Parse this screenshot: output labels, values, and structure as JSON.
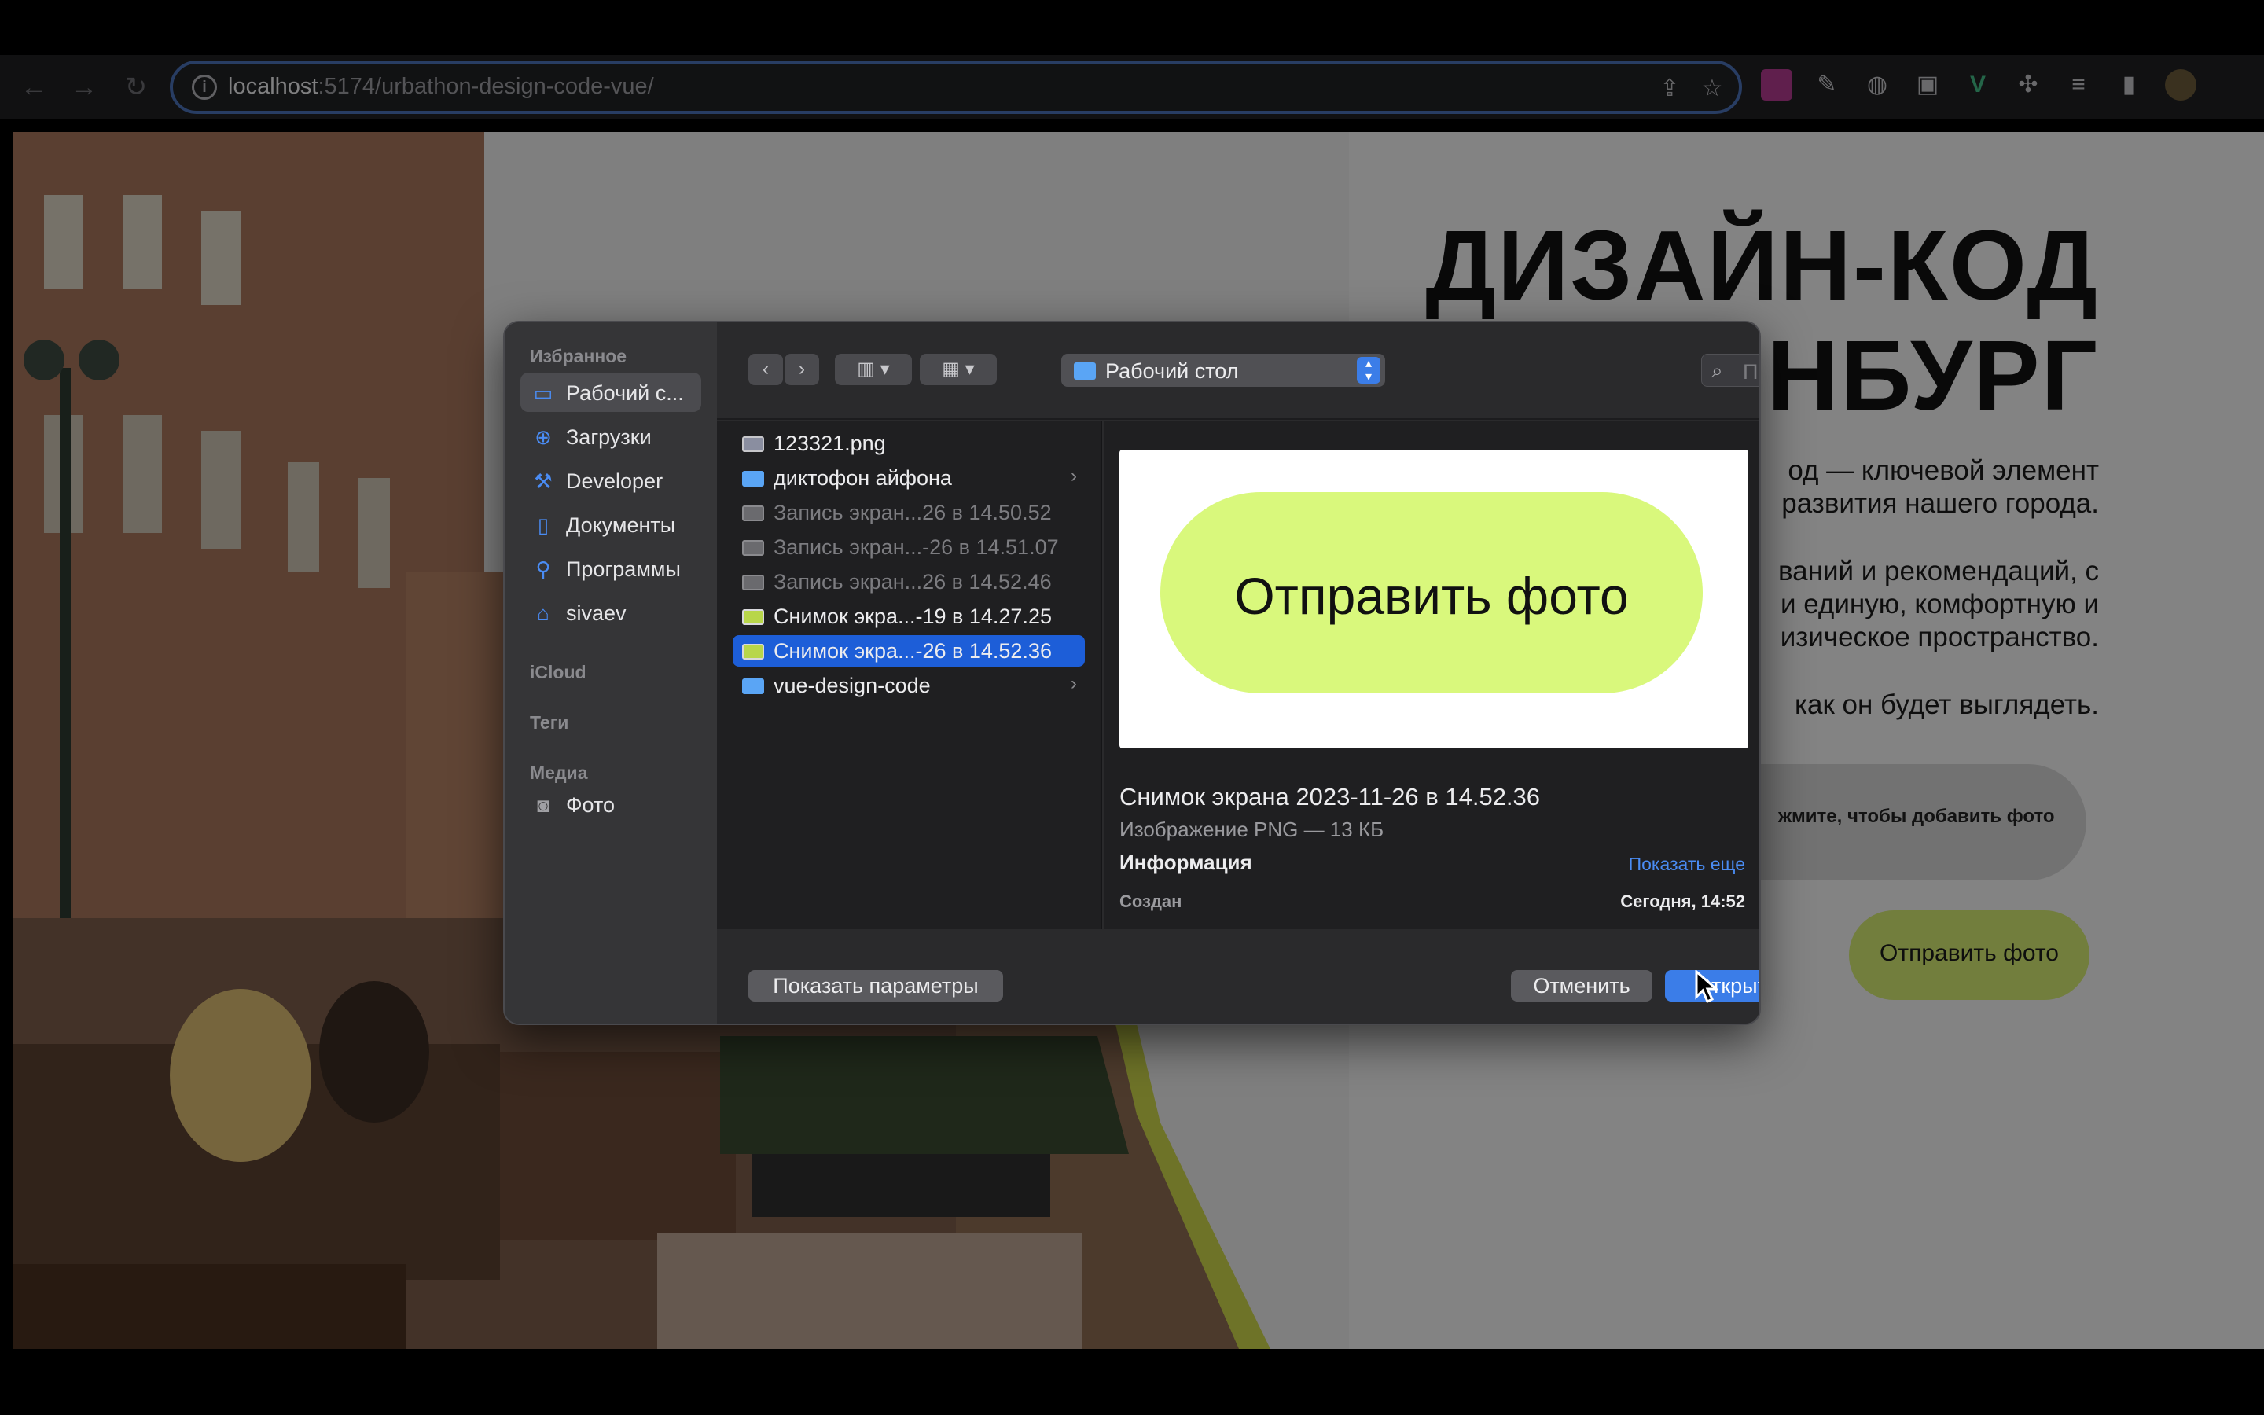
{
  "browser": {
    "url_host": "localhost",
    "url_path": ":5174/urbathon-design-code-vue/"
  },
  "page": {
    "title_line1": "ДИЗАЙН-КОД",
    "title_line2": "НБУРГ",
    "para1_line1": "од — ключевой элемент",
    "para1_line2": "развития нашего города.",
    "para2_line1": "ваний и рекомендаций, с",
    "para2_line2": "и единую, комфортную и",
    "para2_line3": "изическое пространство.",
    "para3": "как он будет выглядеть.",
    "upload_text": "жмите, чтобы добавить фото",
    "send_button": "Отправить фото"
  },
  "sidebar": {
    "favorites_heading": "Избранное",
    "items": [
      {
        "label": "Рабочий с...",
        "icon": "desktop-icon"
      },
      {
        "label": "Загрузки",
        "icon": "downloads-icon"
      },
      {
        "label": "Developer",
        "icon": "hammer-icon"
      },
      {
        "label": "Документы",
        "icon": "document-icon"
      },
      {
        "label": "Программы",
        "icon": "applications-icon"
      },
      {
        "label": "sivaev",
        "icon": "home-icon"
      }
    ],
    "icloud_heading": "iCloud",
    "tags_heading": "Теги",
    "media_heading": "Медиа",
    "media_items": [
      {
        "label": "Фото",
        "icon": "camera-icon"
      }
    ]
  },
  "toolbar": {
    "location": "Рабочий стол",
    "search_placeholder": "Поиск"
  },
  "files": [
    {
      "name": "123321.png",
      "type": "image"
    },
    {
      "name": "диктофон айфона",
      "type": "folder"
    },
    {
      "name": "Запись экран...26 в 14.50.52",
      "type": "video"
    },
    {
      "name": "Запись экран...-26 в 14.51.07",
      "type": "video"
    },
    {
      "name": "Запись экран...26 в 14.52.46",
      "type": "video"
    },
    {
      "name": "Снимок экра...-19 в 14.27.25",
      "type": "image2"
    },
    {
      "name": "Снимок экра...-26 в 14.52.36",
      "type": "image2"
    },
    {
      "name": "vue-design-code",
      "type": "folder"
    }
  ],
  "preview": {
    "thumb_text": "Отправить фото",
    "name": "Снимок экрана 2023-11-26 в 14.52.36",
    "subtitle": "Изображение PNG — 13 КБ",
    "info_heading": "Информация",
    "show_more": "Показать еще",
    "created_label": "Создан",
    "created_value": "Сегодня, 14:52"
  },
  "buttons": {
    "options": "Показать параметры",
    "cancel": "Отменить",
    "open": "Открыть"
  }
}
